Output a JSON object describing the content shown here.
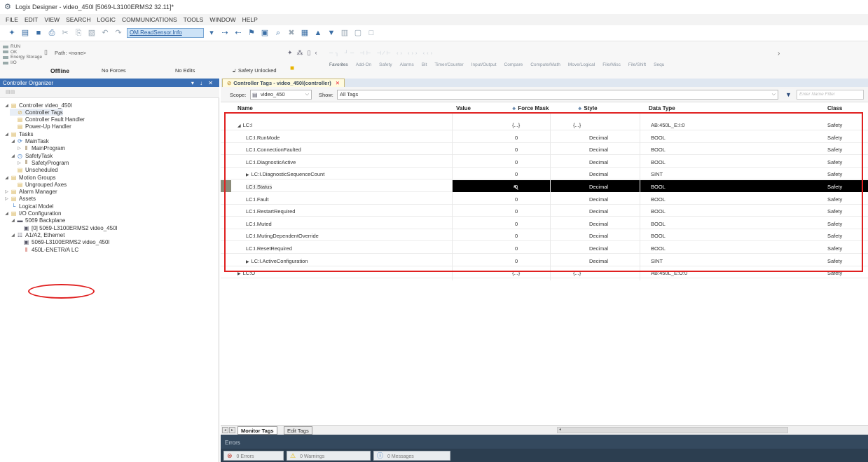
{
  "window": {
    "title": "Logix Designer - video_450l [5069-L3100ERMS2 32.11]*"
  },
  "menu": [
    "FILE",
    "EDIT",
    "VIEW",
    "SEARCH",
    "LOGIC",
    "COMMUNICATIONS",
    "TOOLS",
    "WINDOW",
    "HELP"
  ],
  "toolbar": {
    "combo_value": "OM.ReadSensor.Info"
  },
  "status": {
    "lines": [
      "RUN",
      "OK",
      "Energy Storage",
      "I/O"
    ],
    "mode": "Offline",
    "path_label": "Path: <none>",
    "forces": "No Forces",
    "edits": "No Edits",
    "safety": "Safety Unlocked",
    "instruction_tabs": [
      "Favorites",
      "Add-On",
      "Safety",
      "Alarms",
      "Bit",
      "Timer/Counter",
      "Input/Output",
      "Compare",
      "Compute/Math",
      "Move/Logical",
      "File/Misc",
      "File/Shift",
      "Sequ"
    ]
  },
  "organizer": {
    "title": "Controller Organizer",
    "tree": [
      {
        "label": "Controller video_450l",
        "icon": "folder-icon",
        "level": 0,
        "twisty": "open"
      },
      {
        "label": "Controller Tags",
        "icon": "tags-icon",
        "level": 1,
        "twisty": ""
      },
      {
        "label": "Controller Fault Handler",
        "icon": "folder-icon",
        "level": 1,
        "twisty": ""
      },
      {
        "label": "Power-Up Handler",
        "icon": "folder-icon",
        "level": 1,
        "twisty": ""
      },
      {
        "label": "Tasks",
        "icon": "folder-icon",
        "level": 0,
        "twisty": "open"
      },
      {
        "label": "MainTask",
        "icon": "task-icon",
        "level": 1,
        "twisty": "open"
      },
      {
        "label": "MainProgram",
        "icon": "program-icon",
        "level": 2,
        "twisty": "closed"
      },
      {
        "label": "SafetyTask",
        "icon": "safety-task-icon",
        "level": 1,
        "twisty": "open"
      },
      {
        "label": "SafetyProgram",
        "icon": "program-icon",
        "level": 2,
        "twisty": "closed"
      },
      {
        "label": "Unscheduled",
        "icon": "folder-icon",
        "level": 1,
        "twisty": ""
      },
      {
        "label": "Motion Groups",
        "icon": "folder-icon",
        "level": 0,
        "twisty": "open"
      },
      {
        "label": "Ungrouped Axes",
        "icon": "folder-icon",
        "level": 1,
        "twisty": ""
      },
      {
        "label": "Alarm Manager",
        "icon": "folder-icon",
        "level": 0,
        "twisty": "closed"
      },
      {
        "label": "Assets",
        "icon": "folder-icon",
        "level": 0,
        "twisty": "closed"
      },
      {
        "label": "Logical Model",
        "icon": "model-icon",
        "level": 0,
        "twisty": ""
      },
      {
        "label": "I/O Configuration",
        "icon": "folder-icon",
        "level": 0,
        "twisty": "open"
      },
      {
        "label": "5069 Backplane",
        "icon": "backplane-icon",
        "level": 1,
        "twisty": "open"
      },
      {
        "label": "[0] 5069-L3100ERMS2 video_450l",
        "icon": "controller-icon",
        "level": 2,
        "twisty": ""
      },
      {
        "label": "A1/A2, Ethernet",
        "icon": "network-icon",
        "level": 1,
        "twisty": "open"
      },
      {
        "label": "5069-L3100ERMS2 video_450l",
        "icon": "controller-icon",
        "level": 2,
        "twisty": ""
      },
      {
        "label": "450L-ENETR/A LC",
        "icon": "light-curtain-icon",
        "level": 2,
        "twisty": ""
      }
    ]
  },
  "main": {
    "tab_label": "Controller Tags - video_450l(controller)",
    "scope_label": "Scope:",
    "scope_value": "video_450",
    "show_label": "Show:",
    "show_value": "All Tags",
    "filter_placeholder": "Enter Name Filter",
    "columns": {
      "name": "Name",
      "value": "Value",
      "force_mask": "Force Mask",
      "style": "Style",
      "data_type": "Data Type",
      "class": "Class"
    },
    "rows": [
      {
        "name": "LC:I",
        "indent": 0,
        "exp": "open",
        "value": "{...}",
        "force": "{...}",
        "style": "",
        "type": "AB:450L_E:I:0",
        "class": "Safety"
      },
      {
        "name": "LC:I.RunMode",
        "indent": 1,
        "exp": "",
        "value": "0",
        "force": "",
        "style": "Decimal",
        "type": "BOOL",
        "class": "Safety"
      },
      {
        "name": "LC:I.ConnectionFaulted",
        "indent": 1,
        "exp": "",
        "value": "0",
        "force": "",
        "style": "Decimal",
        "type": "BOOL",
        "class": "Safety"
      },
      {
        "name": "LC:I.DiagnosticActive",
        "indent": 1,
        "exp": "",
        "value": "0",
        "force": "",
        "style": "Decimal",
        "type": "BOOL",
        "class": "Safety"
      },
      {
        "name": "LC:I.DiagnosticSequenceCount",
        "indent": 1,
        "exp": "closed",
        "value": "0",
        "force": "",
        "style": "Decimal",
        "type": "SINT",
        "class": "Safety"
      },
      {
        "name": "LC:I.Status",
        "indent": 1,
        "exp": "",
        "value": "0",
        "force": "",
        "style": "Decimal",
        "type": "BOOL",
        "class": "Safety",
        "selected": true
      },
      {
        "name": "LC:I.Fault",
        "indent": 1,
        "exp": "",
        "value": "0",
        "force": "",
        "style": "Decimal",
        "type": "BOOL",
        "class": "Safety"
      },
      {
        "name": "LC:I.RestartRequired",
        "indent": 1,
        "exp": "",
        "value": "0",
        "force": "",
        "style": "Decimal",
        "type": "BOOL",
        "class": "Safety"
      },
      {
        "name": "LC:I.Muted",
        "indent": 1,
        "exp": "",
        "value": "0",
        "force": "",
        "style": "Decimal",
        "type": "BOOL",
        "class": "Safety"
      },
      {
        "name": "LC:I.MutingDependentOverride",
        "indent": 1,
        "exp": "",
        "value": "0",
        "force": "",
        "style": "Decimal",
        "type": "BOOL",
        "class": "Safety"
      },
      {
        "name": "LC:I.ResetRequired",
        "indent": 1,
        "exp": "",
        "value": "0",
        "force": "",
        "style": "Decimal",
        "type": "BOOL",
        "class": "Safety"
      },
      {
        "name": "LC:I.ActiveConfiguration",
        "indent": 1,
        "exp": "closed",
        "value": "0",
        "force": "",
        "style": "Decimal",
        "type": "SINT",
        "class": "Safety"
      },
      {
        "name": "LC:O",
        "indent": 0,
        "exp": "closed",
        "value": "{...}",
        "force": "{...}",
        "style": "",
        "type": "AB:450L_E:O:0",
        "class": "Safety"
      }
    ],
    "bottom_tabs": {
      "monitor": "Monitor Tags",
      "edit": "Edit Tags"
    }
  },
  "errors": {
    "title": "Errors",
    "errors": "0 Errors",
    "warnings": "0 Warnings",
    "messages": "0 Messages"
  },
  "colors": {
    "header_blue": "#3b6fb4",
    "highlight_red": "#e02020",
    "selection_black": "#000000"
  }
}
